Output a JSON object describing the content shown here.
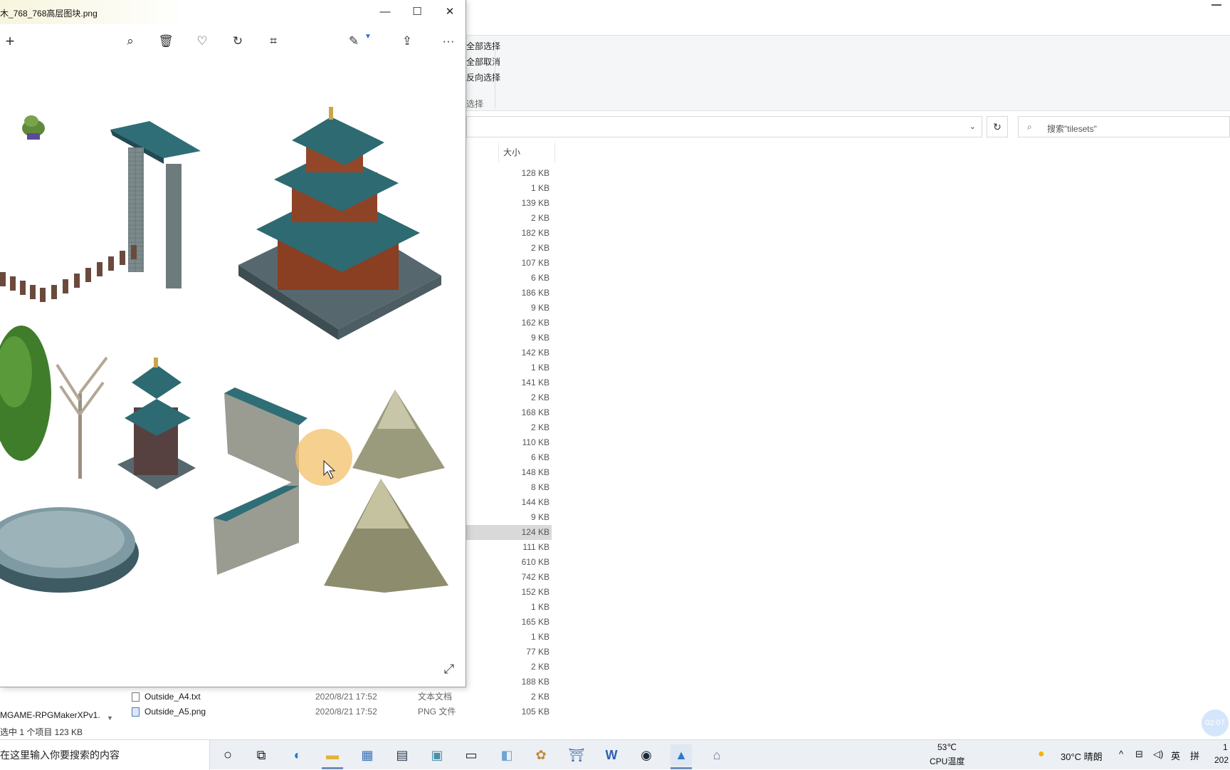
{
  "viewer": {
    "title": "木_768_768高层图块.png",
    "win_controls": {
      "minimize": "—",
      "maximize": "☐",
      "close": "✕"
    },
    "toolbar": {
      "add": "+",
      "zoom": "⌕",
      "delete": "🗑",
      "favorite": "♡",
      "rotate": "↻",
      "crop": "⌗",
      "edit": "✎",
      "share": "⇪",
      "more": "···"
    },
    "expand": "⤢"
  },
  "explorer": {
    "ribbon": [
      "全部选择",
      "全部取消",
      "反向选择"
    ],
    "ribbon_group": "选择",
    "search_placeholder": "搜索\"tilesets\"",
    "refresh": "↻",
    "addr_chevron": "⌄",
    "size_header": "大小",
    "sizes": [
      "128 KB",
      "1 KB",
      "139 KB",
      "2 KB",
      "182 KB",
      "2 KB",
      "107 KB",
      "6 KB",
      "186 KB",
      "9 KB",
      "162 KB",
      "9 KB",
      "142 KB",
      "1 KB",
      "141 KB",
      "2 KB",
      "168 KB",
      "2 KB",
      "110 KB",
      "6 KB",
      "148 KB",
      "8 KB",
      "144 KB",
      "9 KB",
      "124 KB",
      "111 KB",
      "610 KB",
      "742 KB",
      "152 KB",
      "1 KB",
      "165 KB",
      "1 KB",
      "77 KB",
      "2 KB",
      "188 KB"
    ],
    "selected_index": 24,
    "files": [
      {
        "name": "Outside_A4.txt",
        "date": "2020/8/21 17:52",
        "type": "文本文档",
        "size": "2 KB",
        "kind": "txt"
      },
      {
        "name": "Outside_A5.png",
        "date": "2020/8/21 17:52",
        "type": "PNG 文件",
        "size": "105 KB",
        "kind": "png"
      }
    ],
    "nav_item": "MGAME-RPGMakerXPv1.",
    "status": "选中 1 个项目  123 KB",
    "timer": "02:07"
  },
  "taskbar": {
    "search_text": "在这里输入你要搜索的内容",
    "cpu_temp": "53℃",
    "cpu_label": "CPU温度",
    "weather": "30°C 晴朗",
    "ime": "英",
    "ime2": "拼",
    "clock_time": "1",
    "clock_date": "202",
    "tray_chevron": "^"
  }
}
